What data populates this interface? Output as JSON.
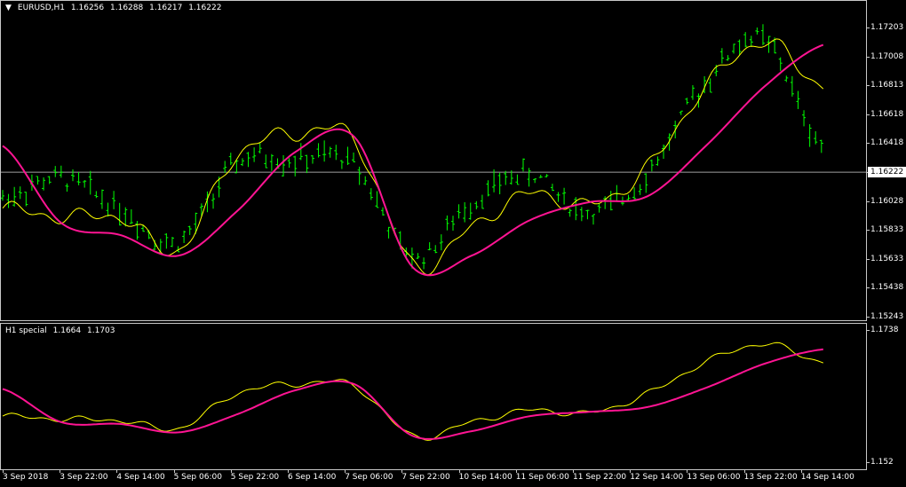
{
  "chart_header": {
    "symbol": "EURUSD,H1",
    "open": "1.16256",
    "high": "1.16288",
    "low": "1.16217",
    "close": "1.16222"
  },
  "indicator_header": {
    "name": "H1 special",
    "value1": "1.1664",
    "value2": "1.1703"
  },
  "price_axis": [
    "1.17203",
    "1.17008",
    "1.16813",
    "1.16618",
    "1.16418",
    "1.16222",
    "1.16028",
    "1.15833",
    "1.15633",
    "1.15438",
    "1.15243"
  ],
  "current_price": "1.16222",
  "indicator_axis": [
    "1.1738",
    "1.152"
  ],
  "time_axis": [
    "3 Sep 2018",
    "3 Sep 22:00",
    "4 Sep 14:00",
    "5 Sep 06:00",
    "5 Sep 22:00",
    "6 Sep 14:00",
    "7 Sep 06:00",
    "7 Sep 22:00",
    "10 Sep 14:00",
    "11 Sep 06:00",
    "11 Sep 22:00",
    "12 Sep 14:00",
    "13 Sep 06:00",
    "13 Sep 22:00",
    "14 Sep 14:00"
  ],
  "colors": {
    "background": "#000000",
    "bars": "#00ff00",
    "fast_line": "#ffff00",
    "slow_line": "#ff1493",
    "grid_border": "#c8c8c8",
    "price_line": "#a0a0a0"
  },
  "chart_data": {
    "type": "line",
    "price_chart": {
      "ylim": [
        1.15243,
        1.17203
      ],
      "x": [
        "3 Sep 2018",
        "3 Sep 22:00",
        "4 Sep 14:00",
        "5 Sep 06:00",
        "5 Sep 22:00",
        "6 Sep 14:00",
        "7 Sep 06:00",
        "7 Sep 22:00",
        "10 Sep 14:00",
        "11 Sep 06:00",
        "11 Sep 22:00",
        "12 Sep 14:00",
        "13 Sep 06:00",
        "13 Sep 22:00",
        "14 Sep 14:00"
      ],
      "bar_mid": [
        1.1605,
        1.1618,
        1.1598,
        1.1575,
        1.1628,
        1.163,
        1.1628,
        1.1565,
        1.1601,
        1.1621,
        1.1595,
        1.162,
        1.1682,
        1.1712,
        1.164
      ],
      "fast_series": [
        1.1598,
        1.1592,
        1.1592,
        1.157,
        1.1634,
        1.1648,
        1.1644,
        1.156,
        1.1585,
        1.1608,
        1.16,
        1.1625,
        1.168,
        1.171,
        1.168
      ],
      "slow_series": [
        1.164,
        1.1588,
        1.158,
        1.1566,
        1.1596,
        1.1636,
        1.1646,
        1.1558,
        1.1566,
        1.159,
        1.1602,
        1.1606,
        1.164,
        1.168,
        1.1708
      ]
    },
    "indicator_chart": {
      "ylim": [
        1.152,
        1.1738
      ],
      "x": [
        "3 Sep 2018",
        "3 Sep 22:00",
        "4 Sep 14:00",
        "5 Sep 06:00",
        "5 Sep 22:00",
        "6 Sep 14:00",
        "7 Sep 06:00",
        "7 Sep 22:00",
        "10 Sep 14:00",
        "11 Sep 06:00",
        "11 Sep 22:00",
        "12 Sep 14:00",
        "13 Sep 06:00",
        "13 Sep 22:00",
        "14 Sep 14:00"
      ],
      "fast_series": [
        1.1595,
        1.159,
        1.1588,
        1.1575,
        1.1633,
        1.1648,
        1.1645,
        1.1562,
        1.1585,
        1.1605,
        1.16,
        1.1632,
        1.1685,
        1.1715,
        1.1685
      ],
      "slow_series": [
        1.164,
        1.1585,
        1.1582,
        1.1568,
        1.1598,
        1.1638,
        1.1648,
        1.1562,
        1.157,
        1.1595,
        1.1602,
        1.161,
        1.1642,
        1.1682,
        1.1706
      ]
    }
  }
}
